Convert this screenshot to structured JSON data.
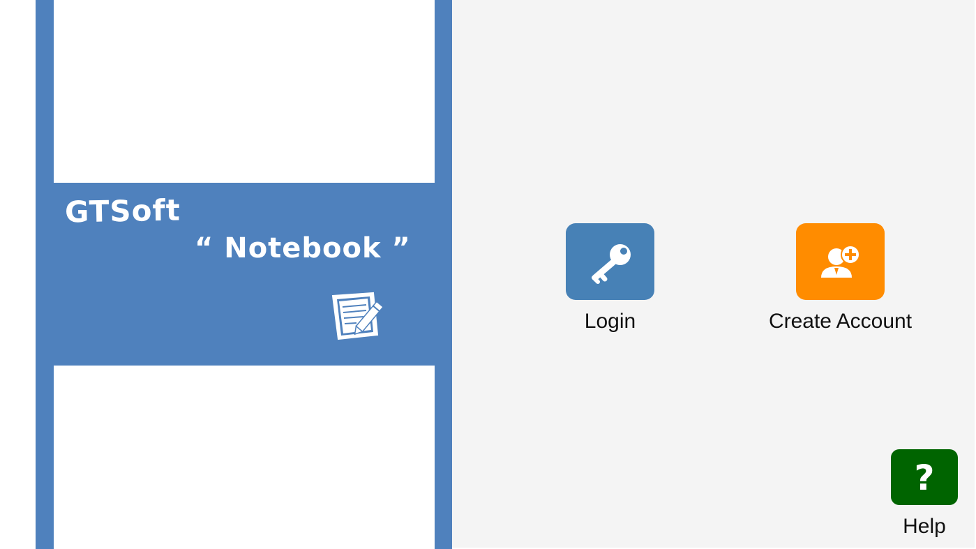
{
  "brand": {
    "company": "GTSoft",
    "product": "“ Notebook ”"
  },
  "actions": {
    "login_label": "Login",
    "create_account_label": "Create Account",
    "help_label": "Help",
    "help_glyph": "?"
  },
  "icons": {
    "brand_icon": "notebook-edit-icon",
    "login_icon": "key-icon",
    "create_account_icon": "add-user-icon",
    "help_icon": "question-mark-icon"
  },
  "colors": {
    "brand_panel": "#4f81bd",
    "login_tile": "#4781b6",
    "create_account_tile": "#ff8c00",
    "help_tile": "#006400",
    "right_background": "#f4f4f4"
  }
}
